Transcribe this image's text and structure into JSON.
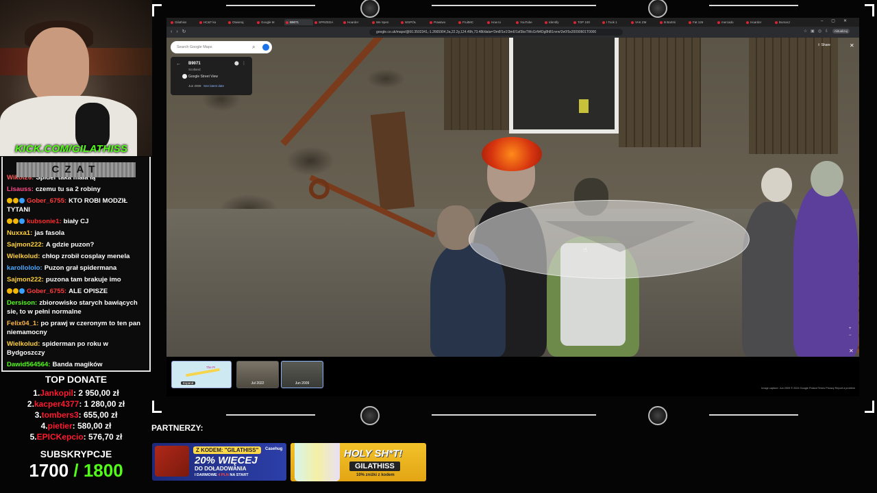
{
  "overlay": {
    "kick_url": "KICK.COM/GILATHISS",
    "chat_title": "CZAT",
    "chat_messages": [
      {
        "user": "Wikol26:",
        "text": "Spider taka mała łą",
        "color": "#ff5a5a",
        "badges": false
      },
      {
        "user": "Lisauss:",
        "text": "czemu tu sa 2 robiny",
        "color": "#ff4a8a",
        "badges": false
      },
      {
        "user": "Gober_6755:",
        "text": "KTO ROBI MODZIŁ TYTANI",
        "color": "#ff3b3b",
        "badges": true
      },
      {
        "user": "kubsonie1:",
        "text": "biały CJ",
        "color": "#ff2b2b",
        "badges": true
      },
      {
        "user": "Nuxxa1:",
        "text": "jas fasola",
        "color": "#ffd23a",
        "badges": false
      },
      {
        "user": "Sajmon222:",
        "text": "A gdzie puzon?",
        "color": "#ffd23a",
        "badges": false
      },
      {
        "user": "Wielkolud:",
        "text": "chłop zrobił cosplay menela",
        "color": "#ffd23a",
        "badges": false
      },
      {
        "user": "karollololo:",
        "text": "Puzon grał spidermana",
        "color": "#4aa8ff",
        "badges": false
      },
      {
        "user": "Sajmon222:",
        "text": "puzona tam brakuje imo",
        "color": "#ffd23a",
        "badges": false
      },
      {
        "user": "Gober_6755:",
        "text": "ALE OPISZE",
        "color": "#ff3b3b",
        "badges": true
      },
      {
        "user": "Dersison:",
        "text": "zbiorowisko starych bawiących sie, to w pełni normalne",
        "color": "#53fc18",
        "badges": false
      },
      {
        "user": "Felix04_1:",
        "text": "po prawj w czeronym to ten pan niemamocny",
        "color": "#ffb84a",
        "badges": false
      },
      {
        "user": "Wielkolud:",
        "text": "spiderman po roku w Bydgoszczy",
        "color": "#ffd23a",
        "badges": false
      },
      {
        "user": "Dawid564564:",
        "text": "Banda magików",
        "color": "#53fc18",
        "badges": false
      }
    ],
    "top_donate_title": "TOP DONATE",
    "top_donate": [
      {
        "rank": "1.",
        "name": "Jankopil",
        "amount": "2 950,00 zł"
      },
      {
        "rank": "2.",
        "name": "kacper4377",
        "amount": "1 280,00 zł"
      },
      {
        "rank": "3.",
        "name": "tombers3",
        "amount": "655,00 zł"
      },
      {
        "rank": "4.",
        "name": "pietier",
        "amount": "580,00 zł"
      },
      {
        "rank": "5.",
        "name": "EPICKepcio",
        "amount": "576,70 zł"
      }
    ],
    "subs_title": "SUBSKRYPCJE",
    "subs_current": "1700",
    "subs_goal": " / 1800",
    "partners_label": "PARTNERZY:"
  },
  "browser": {
    "tabs": [
      "Gilathiss",
      "HC&T ka",
      "Otwieraj",
      "Google M",
      "B9071",
      "SPRZEDA",
      "Hoarder",
      "We Spen",
      "WSPÓŁ",
      "Prawtwo",
      "FruitMC",
      "How to",
      "YouTube",
      "Identify",
      "TOP 100",
      "I Took 1",
      "VAK ZM",
      "B Bartmi",
      "Fat 126",
      "mercado",
      "Hoarder",
      "Bursacz"
    ],
    "active_tab_index": 4,
    "url": "google.co.uk/maps/@60.3502341,-1.2665904,3a,22.2y,124.49h,73.48t/data=!3m8!1e1!3m6!1sf3bsTWcGrN4Dg8hB1rvrw!2e0!5s20090601T0000",
    "profile": "Aktualizuj"
  },
  "maps": {
    "search_placeholder": "Search Google Maps",
    "place_title": "B9071",
    "place_sub": "Scotland",
    "provider": "Google Street View",
    "capture_date": "Jun 2009",
    "latest_link": "See latest date",
    "share_label": "Share",
    "filmstrip": {
      "map_label": "The Pi",
      "expand_label": "Expand",
      "thumbs": [
        "Jul 2022",
        "Jun 2009"
      ]
    },
    "footer": "Image capture: Jun 2009   © 2024 Google   Poland   Terms   Privacy   Report a problem"
  },
  "partners": {
    "casehug": {
      "code": "Z KODEM: \"GILATHISS\"",
      "brand": "Casehug",
      "line1": "20% WIĘCEJ",
      "line2": "DO DOŁADOWANIA",
      "line3a": "I DARMOWE ",
      "line3b": "4 PLN",
      "line3c": " NA START"
    },
    "holy": {
      "title": "HOLY SH*T!",
      "code": "GILATHISS",
      "sub": "10% zniżki z kodem"
    }
  }
}
